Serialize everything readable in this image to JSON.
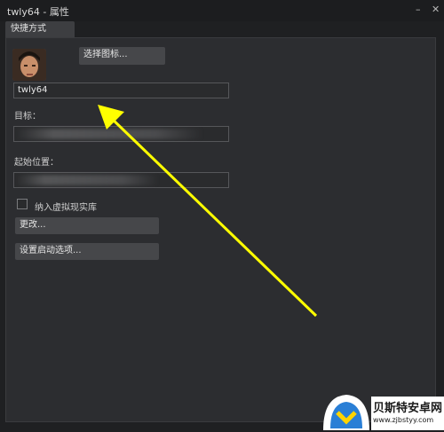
{
  "window": {
    "title": "twly64 - 属性",
    "minimize_icon": "minimize-icon",
    "close_icon": "close-icon"
  },
  "tab": {
    "label": "快捷方式"
  },
  "shortcut": {
    "choose_icon_label": "选择图标...",
    "name_value": "twly64",
    "target_label": "目标：",
    "start_in_label": "起始位置：",
    "vr_library_label": "纳入虚拟现实库",
    "change_label": "更改...",
    "launch_options_label": "设置启动选项..."
  },
  "watermark": {
    "brand": "贝斯特安卓网",
    "url": "www.zjbstyy.com"
  },
  "colors": {
    "arrow": "#ffff00",
    "panel": "#2c2d30",
    "button": "#46474a"
  }
}
